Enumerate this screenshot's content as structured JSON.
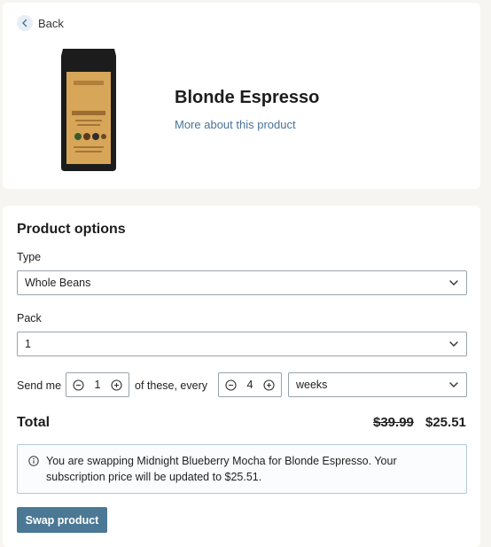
{
  "nav": {
    "back_label": "Back"
  },
  "product": {
    "name": "Blonde Espresso",
    "link_label": "More about this product",
    "colors": {
      "bag": "#1a1a1a",
      "label": "#d9a85b",
      "link": "#4a7399"
    }
  },
  "options": {
    "title": "Product options",
    "type": {
      "label": "Type",
      "value": "Whole Beans"
    },
    "pack": {
      "label": "Pack",
      "value": "1"
    },
    "send": {
      "prefix": "Send me",
      "quantity": "1",
      "middle": "of these, every",
      "interval": "4",
      "unit": "weeks"
    }
  },
  "total": {
    "label": "Total",
    "old_price": "$39.99",
    "new_price": "$25.51"
  },
  "notice": {
    "text": "You are swapping Midnight Blueberry Mocha for Blonde Espresso. Your subscription price will be updated to $25.51."
  },
  "actions": {
    "swap_label": "Swap product",
    "accent": "#4a7895"
  }
}
